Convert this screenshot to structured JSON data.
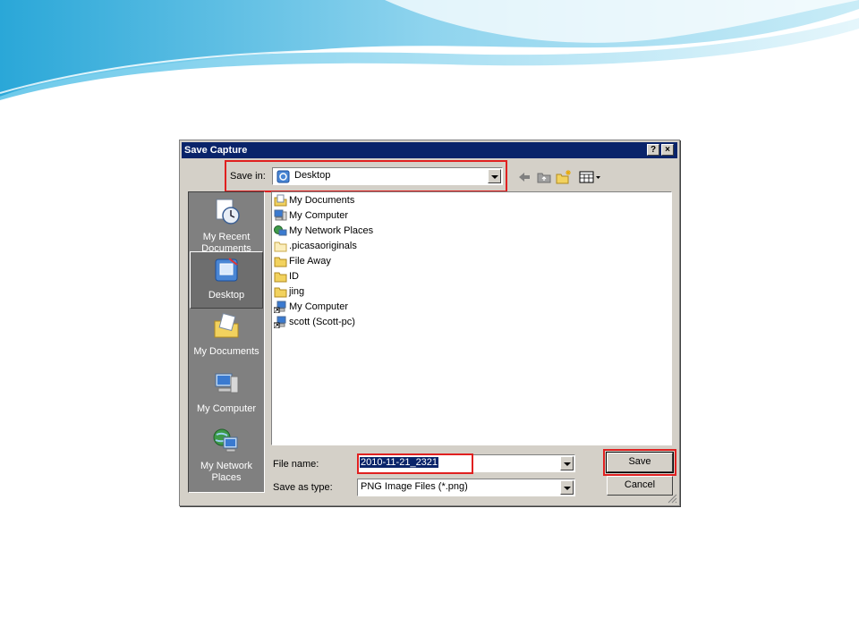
{
  "dialog": {
    "title": "Save Capture",
    "help_label": "?",
    "close_label": "×"
  },
  "save_in": {
    "label": "Save in:",
    "value": "Desktop"
  },
  "places": [
    {
      "label": "My Recent Documents",
      "icon": "recent-documents-icon"
    },
    {
      "label": "Desktop",
      "icon": "desktop-icon",
      "selected": true
    },
    {
      "label": "My Documents",
      "icon": "my-documents-icon"
    },
    {
      "label": "My Computer",
      "icon": "my-computer-icon"
    },
    {
      "label": "My Network Places",
      "icon": "network-places-icon"
    }
  ],
  "files": [
    {
      "name": "My Documents",
      "icon": "my-documents-icon"
    },
    {
      "name": "My Computer",
      "icon": "my-computer-icon"
    },
    {
      "name": "My Network Places",
      "icon": "network-places-icon"
    },
    {
      "name": ".picasaoriginals",
      "icon": "folder-icon"
    },
    {
      "name": "File Away",
      "icon": "folder-icon"
    },
    {
      "name": "ID",
      "icon": "folder-icon"
    },
    {
      "name": "jing",
      "icon": "folder-icon"
    },
    {
      "name": "My Computer",
      "icon": "shortcut-icon"
    },
    {
      "name": "scott (Scott-pc)",
      "icon": "shortcut-icon"
    }
  ],
  "file_name": {
    "label": "File name:",
    "value": "2010-11-21_2321"
  },
  "save_as_type": {
    "label": "Save as type:",
    "value": "PNG Image Files (*.png)"
  },
  "buttons": {
    "save": "Save",
    "cancel": "Cancel"
  },
  "colors": {
    "titlebar": "#0a246a",
    "highlight": "#e02020",
    "dialog_face": "#d4d0c8"
  }
}
